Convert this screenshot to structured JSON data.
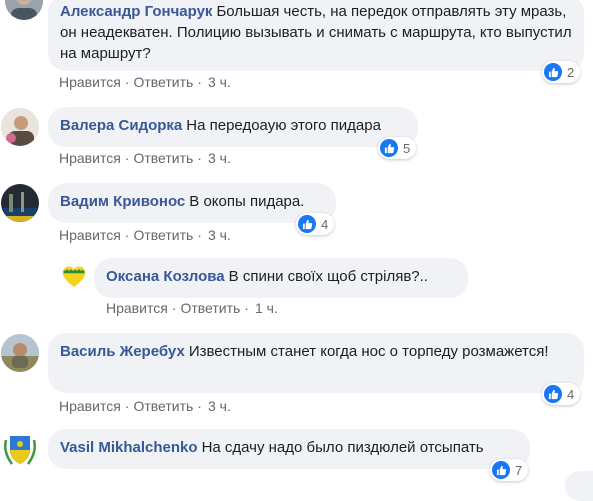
{
  "actions": {
    "like": "Нравится",
    "reply": "Ответить",
    "separator": "·"
  },
  "comments": [
    {
      "author": "Александр Гончарук",
      "text": "Большая честь, на передок отправлять эту мразь, он неадекватен. Полицию вызывать и снимать с маршрута, кто выпустил на маршрут?",
      "time": "3 ч.",
      "reactions": "2"
    },
    {
      "author": "Валера Сидорка",
      "text": "На передоаую этого пидара",
      "time": "3 ч.",
      "reactions": "5"
    },
    {
      "author": "Вадим Кривонос",
      "text": "В окопы пидара.",
      "time": "3 ч.",
      "reactions": "4"
    },
    {
      "author": "Оксана Козлова",
      "text": "В спини своїх щоб стріляв?..",
      "time": "1 ч."
    },
    {
      "author": "Василь Жеребух",
      "text": "Известным станет когда нос о торпеду розмажется!",
      "time": "3 ч.",
      "reactions": "4"
    },
    {
      "author": "Vasil Mikhalchenko",
      "text": "На сдачу надо было пиздюлей отсыпать",
      "reactions": "7"
    }
  ],
  "colors": {
    "author": "#385898",
    "bubble": "#f0f2f5",
    "like_badge": "#1877f2",
    "meta": "#65676b"
  },
  "icons": {
    "reaction": "like-thumb-icon"
  }
}
